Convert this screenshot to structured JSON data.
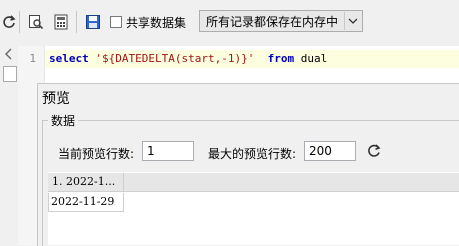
{
  "toolbar": {
    "share_dataset_label": "共享数据集",
    "storage_mode_value": "所有记录都保存在内存中",
    "icons": [
      "refresh-icon",
      "preview-icon",
      "calculator-icon",
      "save-icon"
    ]
  },
  "editor": {
    "line_number": "1",
    "code_keyword_select": "select",
    "code_string": "'${DATEDELTA(start,-1)}'",
    "code_keyword_from": "from",
    "code_table": "dual"
  },
  "preview": {
    "title": "预览",
    "group_label": "数据",
    "current_rows_label": "当前预览行数:",
    "current_rows_value": "1",
    "max_rows_label": "最大的预览行数:",
    "max_rows_value": "200",
    "grid": {
      "header": "1. 2022-1...",
      "cell": "2022-11-29"
    }
  }
}
